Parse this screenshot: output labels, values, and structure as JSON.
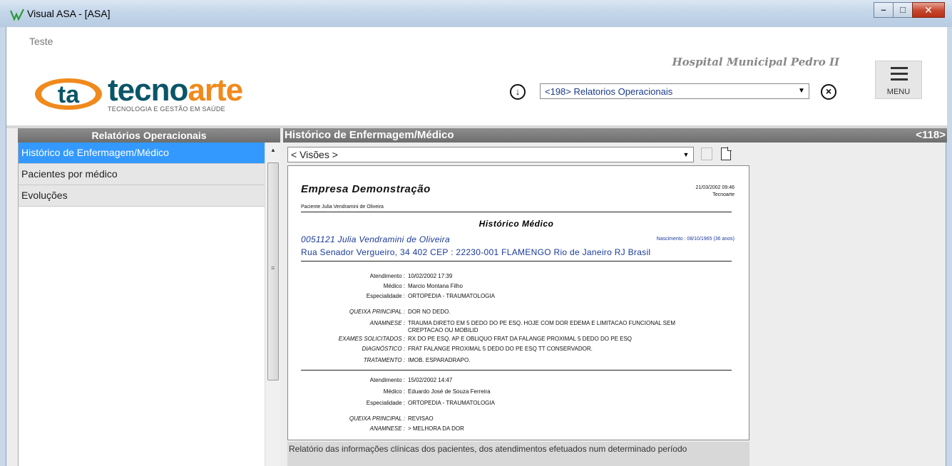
{
  "window": {
    "title": "Visual ASA - [ASA]"
  },
  "header": {
    "env_label": "Teste",
    "logo": {
      "mark": "ta",
      "word_a": "tecno",
      "word_b": "arte",
      "tagline": "TECNOLOGIA E GESTÃO EM SAÚDE"
    },
    "hospital_name": "Hospital Municipal Pedro II",
    "module_select": {
      "value": "<198> Relatorios Operacionais"
    },
    "menu_label": "MENU"
  },
  "sidebar": {
    "title": "Relatórios Operacionais",
    "items": [
      {
        "label": "Histórico de Enfermagem/Médico",
        "selected": true
      },
      {
        "label": "Pacientes por médico",
        "selected": false
      },
      {
        "label": "Evoluções",
        "selected": false
      }
    ]
  },
  "report": {
    "title": "Histórico de Enfermagem/Médico",
    "code": "<118>",
    "views_value": "< Visões >",
    "description": "Relatório das informações clínicas dos pacientes, dos atendimentos efetuados num determinado período"
  },
  "document": {
    "company": "Empresa Demonstração",
    "date": "21/03/2002  09:46",
    "user": "Tecnoarte",
    "patient_small": "Paciente Julia Vendramini de Oliveira",
    "heading": "Histórico Médico",
    "patient_line": "0051121 Julia Vendramini de Oliveira",
    "birth": "Nascimento : 08/10/1965 (36 anos)",
    "address": "Rua Senador Vergueiro, 34 402  CEP : 22230-001  FLAMENGO  Rio de Janeiro  RJ  Brasil",
    "visit1": {
      "atendimento_k": "Atendimento :",
      "atendimento_v": "10/02/2002  17:39",
      "medico_k": "Médico :",
      "medico_v": "Marcio Montana Filho",
      "esp_k": "Especialidade :",
      "esp_v": "ORTOPEDIA - TRAUMATOLOGIA",
      "queixa_k": "QUEIXA PRINCIPAL :",
      "queixa_v": "DOR NO DEDO.",
      "anamnese_k": "ANAMNESE :",
      "anamnese_v1": "TRAUMA DIRETO EM 5 DEDO DO PE ESQ. HOJE COM DOR EDEMA E LIMITACAO FUNCIONAL SEM",
      "anamnese_v2": "CREPTACAO OU MOBILID",
      "exames_k": "EXAMES SOLICITADOS :",
      "exames_v": "RX DO PE ESQ. AP E OBLIQUO FRAT DA FALANGE PROXIMAL 5 DEDO DO PE ESQ",
      "diag_k": "DIAGNÓSTICO :",
      "diag_v": "FRAT FALANGE PROXIMAL 5 DEDO DO PE ESQ TT CONSERVADOR.",
      "trat_k": "TRATAMENTO :",
      "trat_v": "IMOB. ESPARADRAPO."
    },
    "visit2": {
      "atendimento_k": "Atendimento :",
      "atendimento_v": "15/02/2002  14:47",
      "medico_k": "Médico :",
      "medico_v": "Eduardo José de Souza Ferreira",
      "esp_k": "Especialidade :",
      "esp_v": "ORTOPEDIA - TRAUMATOLOGIA",
      "queixa_k": "QUEIXA PRINCIPAL :",
      "queixa_v": "REVISAO",
      "anamnese_k": "ANAMNESE :",
      "anamnese_v": "> MELHORA DA DOR"
    }
  },
  "icons": {
    "download": "download-circle-icon",
    "clear": "close-circle-icon",
    "menu": "hamburger-icon",
    "print": "print-icon",
    "new_doc": "document-icon"
  }
}
